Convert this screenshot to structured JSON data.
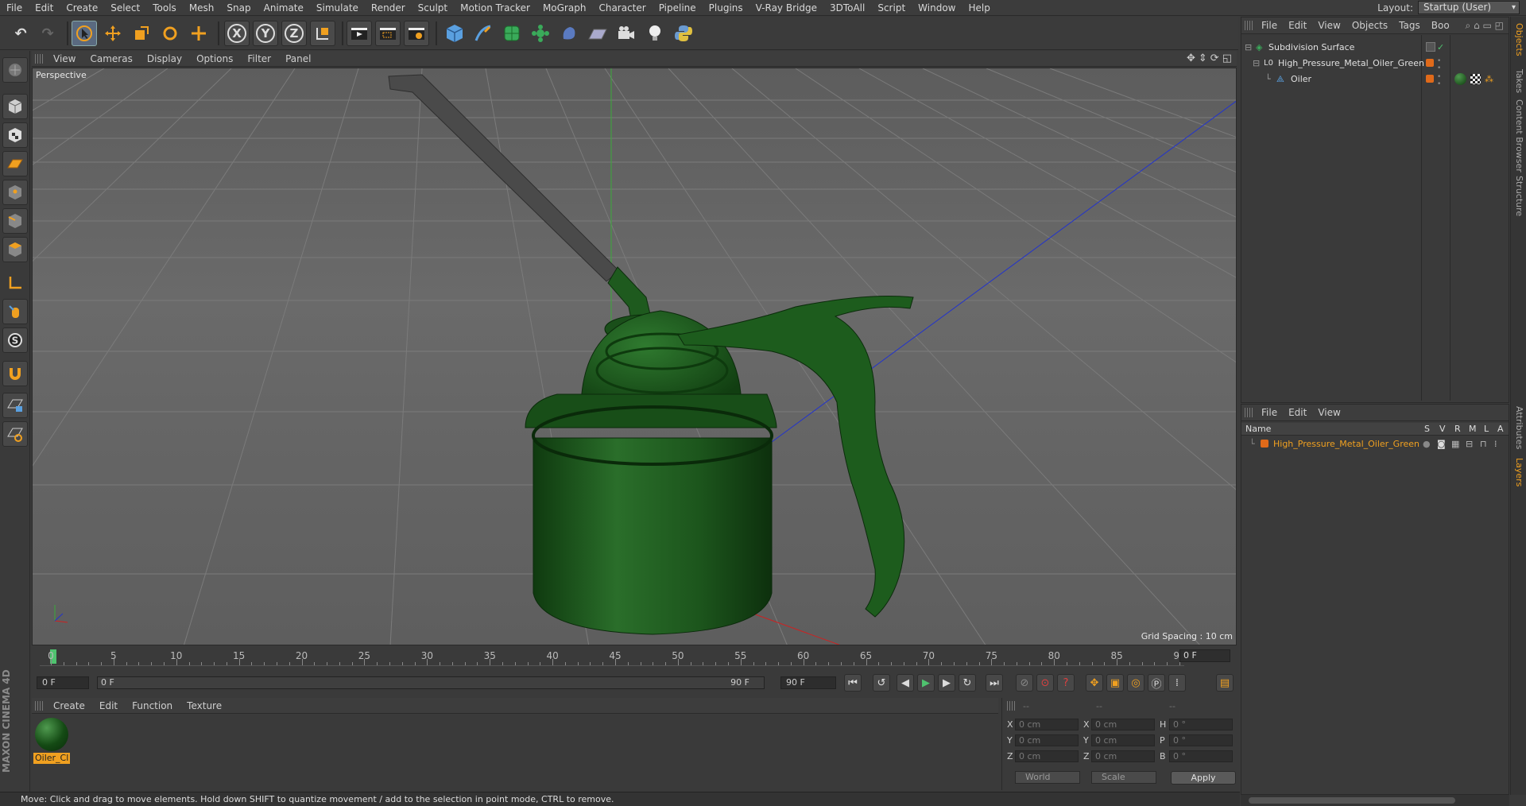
{
  "menubar": {
    "items": [
      "File",
      "Edit",
      "Create",
      "Select",
      "Tools",
      "Mesh",
      "Snap",
      "Animate",
      "Simulate",
      "Render",
      "Sculpt",
      "Motion Tracker",
      "MoGraph",
      "Character",
      "Pipeline",
      "Plugins",
      "V-Ray Bridge",
      "3DToAll",
      "Script",
      "Window",
      "Help"
    ],
    "layout_label": "Layout:",
    "layout_value": "Startup (User)"
  },
  "toolbar": {
    "x": "X",
    "y": "Y",
    "z": "Z"
  },
  "viewport": {
    "menu": [
      "View",
      "Cameras",
      "Display",
      "Options",
      "Filter",
      "Panel"
    ],
    "camera": "Perspective",
    "grid_spacing": "Grid Spacing : 10 cm"
  },
  "timeline": {
    "ticks": [
      "0",
      "5",
      "10",
      "15",
      "20",
      "25",
      "30",
      "35",
      "40",
      "45",
      "50",
      "55",
      "60",
      "65",
      "70",
      "75",
      "80",
      "85",
      "90"
    ],
    "current_frame": "0 F"
  },
  "transport": {
    "start": "0 F",
    "range_start": "0 F",
    "range_end": "90 F",
    "end": "90 F"
  },
  "material_manager": {
    "menu": [
      "Create",
      "Edit",
      "Function",
      "Texture"
    ],
    "material_name": "Oiler_Cl"
  },
  "coordinates": {
    "header_dashes": [
      "--",
      "--",
      "--"
    ],
    "rows": [
      {
        "a": "X",
        "av": "0 cm",
        "b": "X",
        "bv": "0 cm",
        "c": "H",
        "cv": "0 °"
      },
      {
        "a": "Y",
        "av": "0 cm",
        "b": "Y",
        "bv": "0 cm",
        "c": "P",
        "cv": "0 °"
      },
      {
        "a": "Z",
        "av": "0 cm",
        "b": "Z",
        "bv": "0 cm",
        "c": "B",
        "cv": "0 °"
      }
    ],
    "space": "World",
    "mode": "Scale",
    "apply": "Apply"
  },
  "status": "Move: Click and drag to move elements. Hold down SHIFT to quantize movement / add to the selection in point mode, CTRL to remove.",
  "object_manager": {
    "menu": [
      "File",
      "Edit",
      "View",
      "Objects",
      "Tags",
      "Boo"
    ],
    "objects": [
      {
        "name": "Subdivision Surface"
      },
      {
        "name": "High_Pressure_Metal_Oiler_Green"
      },
      {
        "name": "Oiler"
      }
    ]
  },
  "layer_manager": {
    "menu": [
      "File",
      "Edit",
      "View"
    ],
    "columns": [
      "Name",
      "S",
      "V",
      "R",
      "M",
      "L",
      "A"
    ],
    "layers": [
      {
        "name": "High_Pressure_Metal_Oiler_Green",
        "color": "#e06a1a"
      }
    ]
  },
  "right_tabs": [
    "Objects",
    "Takes",
    "Content Browser",
    "Structure",
    "Attributes",
    "Layers"
  ],
  "branding": "MAXON CINEMA 4D",
  "colors": {
    "accent": "#f0a020",
    "oiler_green": "#1e5a1e",
    "playhead": "#4fc36f"
  }
}
